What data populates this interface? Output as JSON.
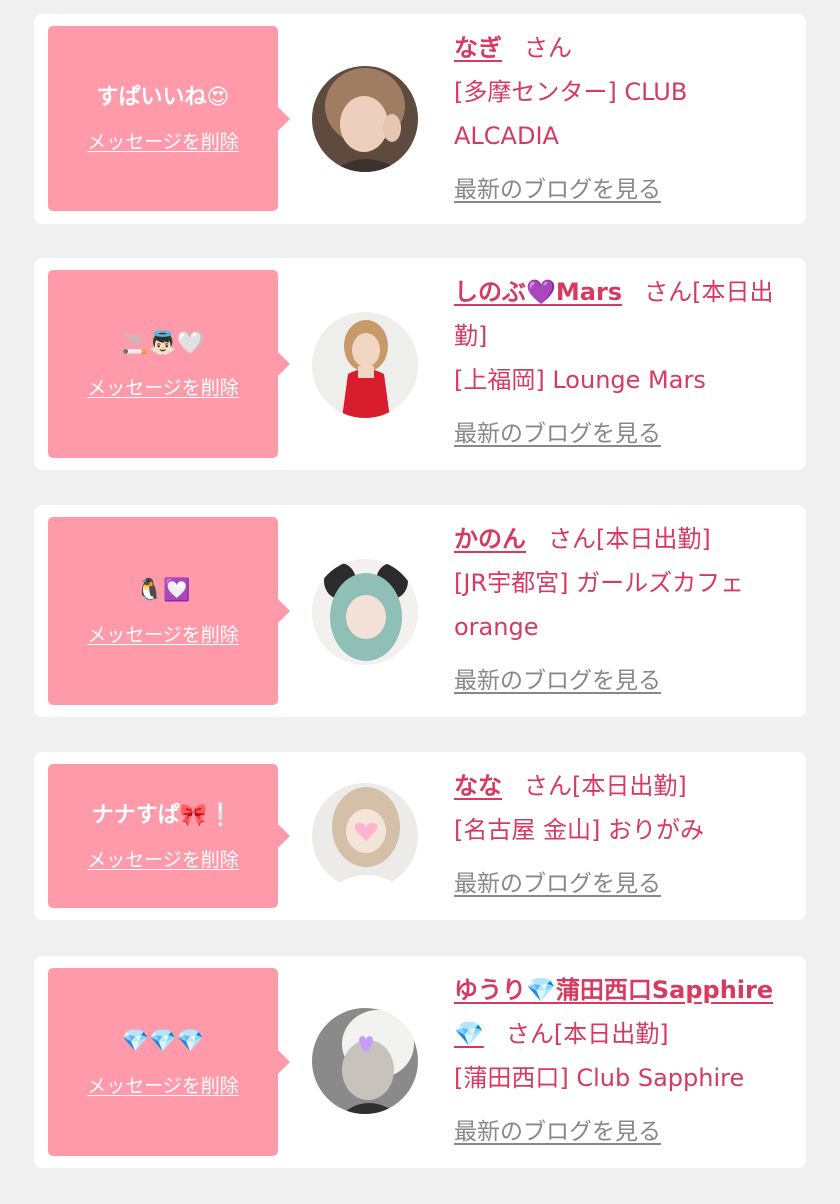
{
  "colors": {
    "background": "#f0f0f0",
    "card": "#ffffff",
    "bubble": "#fe9aaa",
    "accent": "#d73a61",
    "muted": "#888888"
  },
  "delete_label": "メッセージを削除",
  "blog_label": "最新のブログを見る",
  "items": [
    {
      "message": "すぱいいね😍",
      "name": "なぎ",
      "suffix": "さん",
      "location": "[多摩センター] CLUB ALCADIA"
    },
    {
      "message": "🚬👼🏻🤍",
      "name": "しのぶ💜Mars",
      "suffix": "さん[本日出勤]",
      "location": "[上福岡] Lounge Mars"
    },
    {
      "message": "🐧💟",
      "name": "かのん",
      "suffix": "さん[本日出勤]",
      "location": "[JR宇都宮] ガールズカフェorange"
    },
    {
      "message": "ナナすぱ🎀❕",
      "name": "なな",
      "suffix": "さん[本日出勤]",
      "location": "[名古屋 金山] おりがみ"
    },
    {
      "message": "💎💎💎",
      "name": "ゆうり💎蒲田西口Sapphire💎",
      "suffix": "さん[本日出勤]",
      "location": "[蒲田西口] Club Sapphire"
    }
  ]
}
